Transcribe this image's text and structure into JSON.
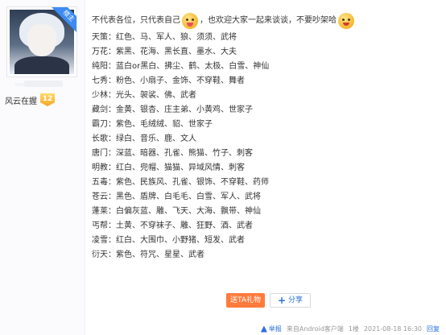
{
  "user": {
    "badge": "楼主",
    "level_name": "风云在握",
    "level": "12"
  },
  "post": {
    "intro_part1": "不代表各位，只代表自己",
    "intro_part2": "，也欢迎大家一起来谈谈，不要吵架哈",
    "lines": [
      "天策：红色、马、军人、狼、须须、武将",
      "万花：紫黑、花海、黑长直、墨水、大夫",
      "纯阳：蓝白or黑白、拂尘、鹤、太极、白雪、神仙",
      "七秀：粉色、小扇子、金饰、不穿鞋、舞者",
      "少林：光头、袈裟、佛、武者",
      "藏剑：金黄、银杏、庄主弟、小黄鸡、世家子",
      "霸刀：紫色、毛绒绒、貂、世家子",
      "长歌：绿白、音乐、鹿、文人",
      "唐门：深蓝、暗器、孔雀、熊猫、竹子、刺客",
      "明教：红白、兜帽、猫猫、异域风情、刺客",
      "五毒：紫色、民族风、孔雀、银饰、不穿鞋、药师",
      "苍云：黑色、盾牌、白毛毛、白雪、军人、武将",
      "蓬莱：白偏灰蓝、雕、飞天、大海、飘带、神仙",
      "丐帮：土黄、不穿袜子、雕、狂野、酒、武者",
      "凌雪：红白、大围巾、小野猪、短发、武者",
      "衍天：紫色、符咒、星星、武者"
    ]
  },
  "actions": {
    "gift": "送TA礼物",
    "share": "分享"
  },
  "footer": {
    "report": "举报",
    "source": "来自Android客户端",
    "floor": "1楼",
    "time": "2021-08-18 16:30",
    "reply": "回复"
  }
}
